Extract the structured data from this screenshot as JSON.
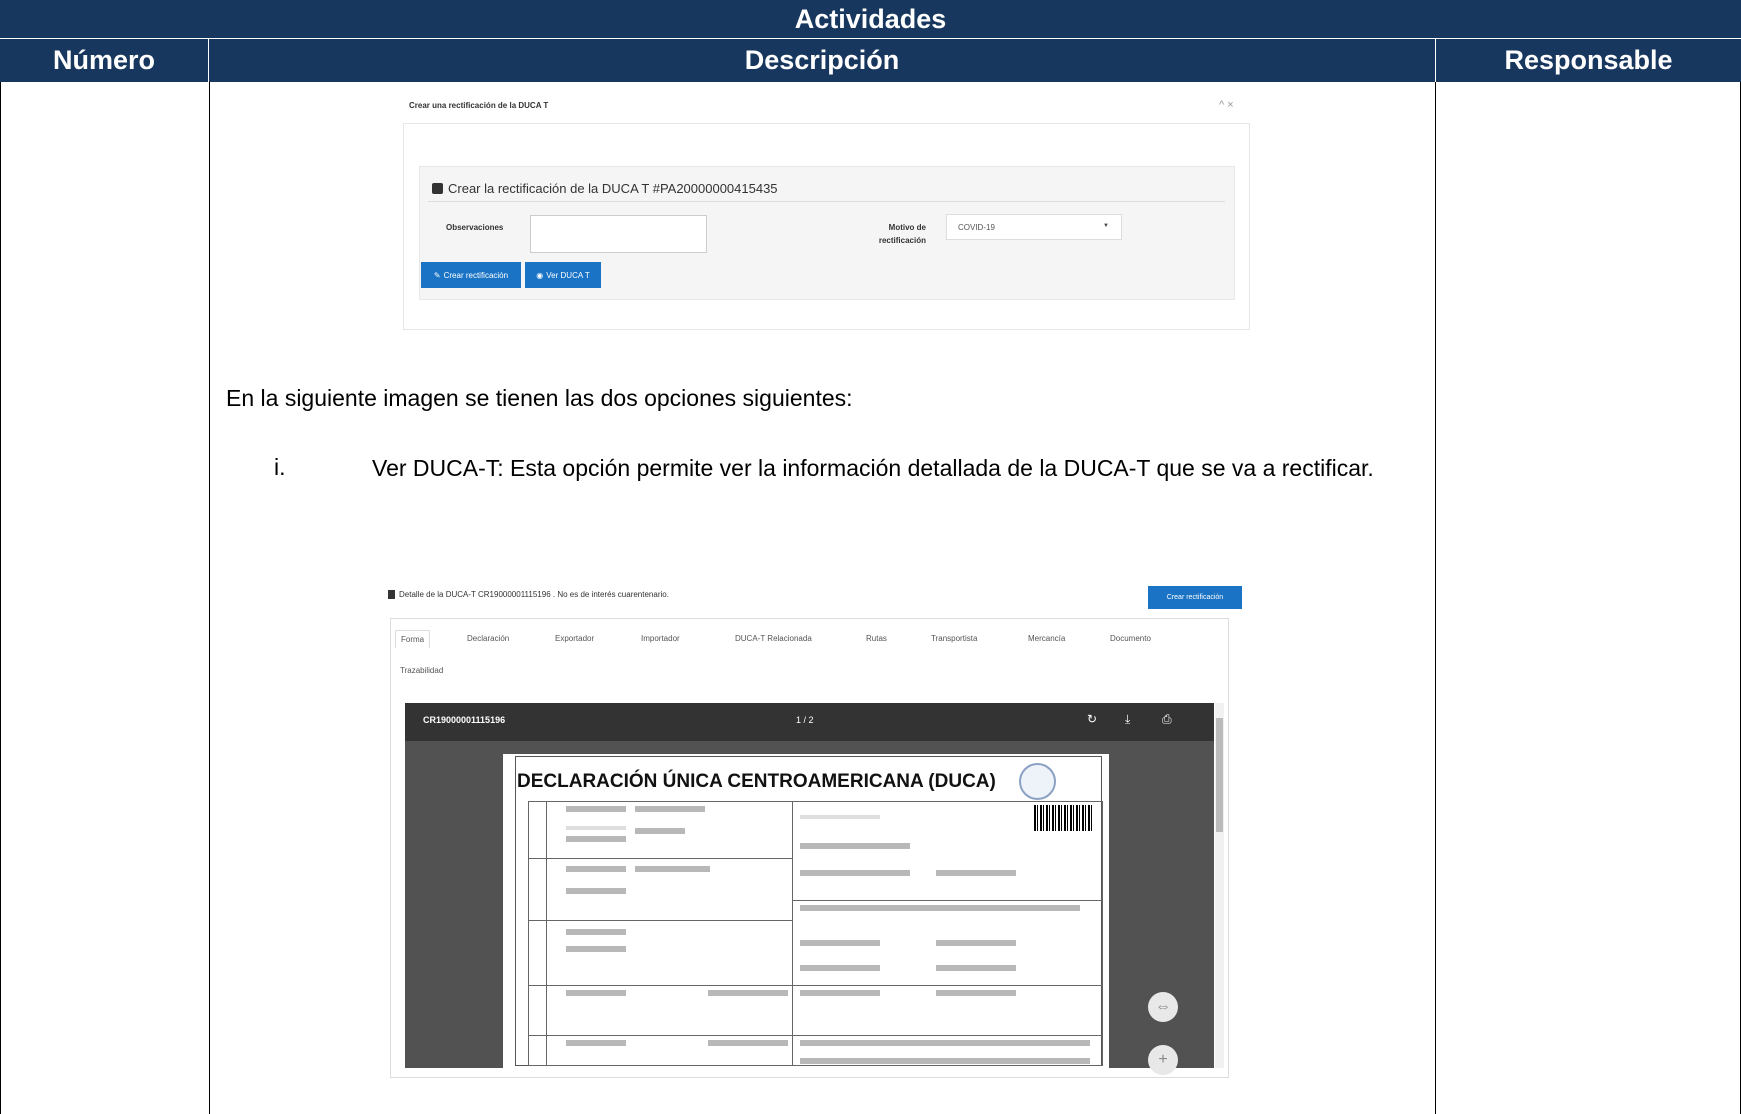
{
  "table": {
    "title": "Actividades",
    "col_numero": "Número",
    "col_descripcion": "Descripción",
    "col_responsable": "Responsable"
  },
  "modal": {
    "title": "Crear una rectificación de la DUCA T",
    "controls": "^ ×",
    "panel_heading": "Crear la rectificación de la DUCA T #PA20000000415435",
    "observaciones_label": "Observaciones",
    "motivo_label": "Motivo de rectificación",
    "motivo_value": "COVID-19",
    "btn_crear": "Crear rectificación",
    "btn_ver": "Ver DUCA T"
  },
  "text": {
    "paragraph": "En la siguiente imagen se tienen las dos opciones siguientes:",
    "item_number": "i.",
    "item_text": "Ver DUCA-T: Esta opción permite ver la información detallada de la DUCA-T que se va a rectificar."
  },
  "detail": {
    "title": "Detalle de la DUCA-T CR19000001115196 . No es de interés cuarentenario.",
    "btn_crear_rect": "Crear rectificación",
    "tabs": [
      "Forma",
      "Declaración",
      "Exportador",
      "Importador",
      "DUCA-T Relacionada",
      "Rutas",
      "Transportista",
      "Mercancía",
      "Documento",
      "Trazabilidad"
    ],
    "viewer_doc": "CR19000001115196",
    "viewer_page": "1 / 2",
    "doc_title": "DECLARACIÓN ÚNICA CENTROAMERICANA (DUCA)"
  }
}
